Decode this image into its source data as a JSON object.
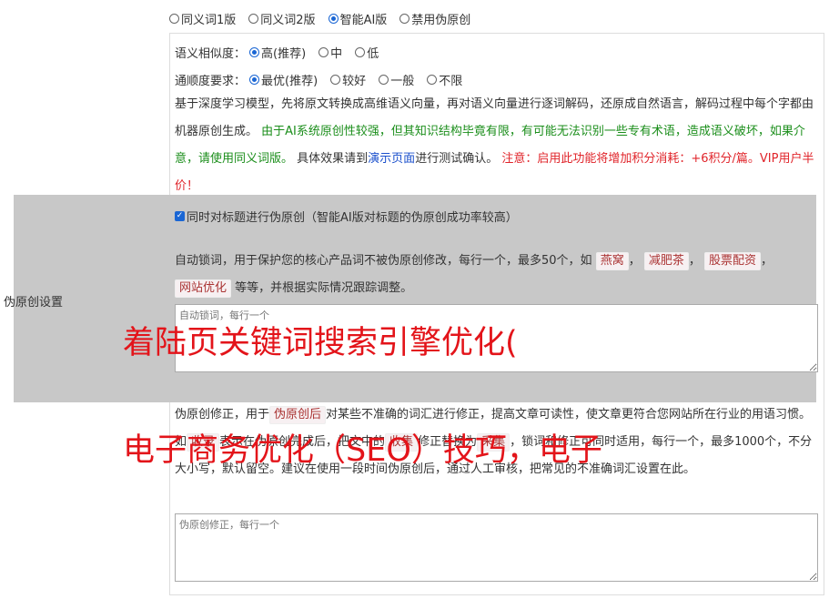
{
  "version_options": [
    {
      "label": "同义词1版",
      "selected": false
    },
    {
      "label": "同义词2版",
      "selected": false
    },
    {
      "label": "智能AI版",
      "selected": true
    },
    {
      "label": "禁用伪原创",
      "selected": false
    }
  ],
  "similarity": {
    "label": "语义相似度：",
    "options": [
      {
        "label": "高(推荐)",
        "selected": true
      },
      {
        "label": "中",
        "selected": false
      },
      {
        "label": "低",
        "selected": false
      }
    ]
  },
  "fluency": {
    "label": "通顺度要求：",
    "options": [
      {
        "label": "最优(推荐)",
        "selected": true
      },
      {
        "label": "较好",
        "selected": false
      },
      {
        "label": "一般",
        "selected": false
      },
      {
        "label": "不限",
        "selected": false
      }
    ]
  },
  "description": {
    "p1": "基于深度学习模型，先将原文转换成高维语义向量，再对语义向量进行逐词解码，还原成自然语言，解码过程中每个字都由机器原创生成。",
    "green": "由于AI系统原创性较强，但其知识结构毕竟有限，有可能无法识别一些专有术语，造成语义破坏，如果介意，请使用同义词版。",
    "p2": "具体效果请到",
    "demo_link": "演示页面",
    "p3": "进行测试确认。",
    "red": "注意：启用此功能将增加积分消耗：+6积分/篇。VIP用户半价！"
  },
  "side_label": "伪原创设置",
  "title_checkbox": {
    "label": "同时对标题进行伪原创（智能AI版对标题的伪原创成功率较高）",
    "checked": true
  },
  "lock_words": {
    "text1": "自动锁词，用于保护您的核心产品词不被伪原创修改，每行一个，最多50个，如",
    "tags": [
      "燕窝",
      "减肥茶",
      "股票配资",
      "网站优化"
    ],
    "text2": "等等，并根据实际情况跟踪调整。",
    "placeholder": "自动锁词，每行一个"
  },
  "correction": {
    "text1": "伪原创修正，用于",
    "tag1": "伪原创后",
    "text2": "对某些不准确的词汇进行修正，提高文章可读性，使文章更符合您网站所在行业的用语习惯。如",
    "tag2": "收录",
    "text3": "表示在伪原创完成后，把文中的",
    "tag3": "收集",
    "text4": "修正替换为",
    "tag4": "采集",
    "text5": "，锁词和修正可同时适用，每行一个，最多1000个，不分大小写，默认留空。建议在使用一段时间伪原创后，通过人工审核，把常见的不准确词汇设置在此。",
    "placeholder": "伪原创修正，每行一个"
  },
  "overlay": {
    "line1": "着陆页关键词搜索引擎优化(",
    "line2": "电子商务优化（SEO）技巧，电子"
  }
}
